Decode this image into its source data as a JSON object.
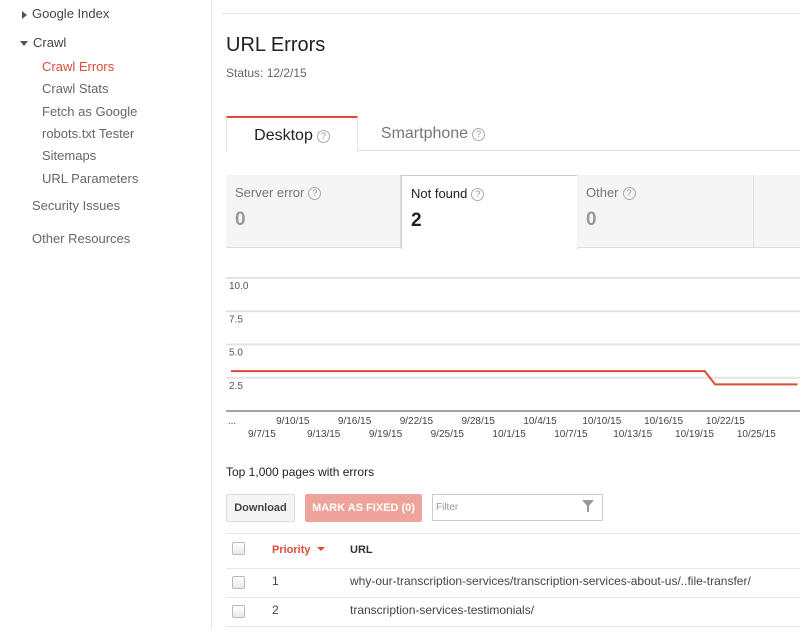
{
  "sidebar": {
    "google_index": "Google Index",
    "crawl": "Crawl",
    "crawl_items": [
      "Crawl Errors",
      "Crawl Stats",
      "Fetch as Google",
      "robots.txt Tester",
      "Sitemaps",
      "URL Parameters"
    ],
    "active_item": "Crawl Errors",
    "security": "Security Issues",
    "other": "Other Resources"
  },
  "header": {
    "title": "URL Errors",
    "status": "Status: 12/2/15"
  },
  "tabs": [
    {
      "label": "Desktop",
      "active": true
    },
    {
      "label": "Smartphone",
      "active": false
    }
  ],
  "help_glyph": "?",
  "cards": [
    {
      "label": "Server error",
      "value": "0"
    },
    {
      "label": "Not found",
      "value": "2",
      "selected": true
    },
    {
      "label": "Other",
      "value": "0"
    }
  ],
  "chart_data": {
    "type": "line",
    "ylim": [
      0,
      10
    ],
    "y_ticks": [
      "10.0",
      "7.5",
      "5.0",
      "2.5"
    ],
    "y_tick_values": [
      10,
      7.5,
      5,
      2.5
    ],
    "x_ticks_upper": [
      "9/10/15",
      "9/16/15",
      "9/22/15",
      "9/28/15",
      "10/4/15",
      "10/10/15",
      "10/16/15",
      "10/22/15"
    ],
    "x_ticks_lower": [
      "9/7/15",
      "9/13/15",
      "9/19/15",
      "9/25/15",
      "10/1/15",
      "10/7/15",
      "10/13/15",
      "10/19/15",
      "10/25/15"
    ],
    "x_ellipsis": "...",
    "grid": true,
    "line_color": "#dd4b39",
    "points": [
      {
        "date": "9/4/15",
        "value": 3
      },
      {
        "date": "10/20/15",
        "value": 3
      },
      {
        "date": "10/21/15",
        "value": 2
      },
      {
        "date": "10/29/15",
        "value": 2
      }
    ]
  },
  "table": {
    "caption": "Top 1,000 pages with errors",
    "download_label": "Download",
    "mark_fixed_label": "MARK AS FIXED (0)",
    "filter_placeholder": "Filter",
    "columns": [
      "Priority",
      "URL"
    ],
    "rows": [
      {
        "priority": "1",
        "url": "why-our-transcription-services/transcription-services-about-us/..file-transfer/"
      },
      {
        "priority": "2",
        "url": "transcription-services-testimonials/"
      }
    ]
  },
  "colors": {
    "accent": "#dd4b39",
    "mark_fixed_bg": "#eea39b"
  }
}
